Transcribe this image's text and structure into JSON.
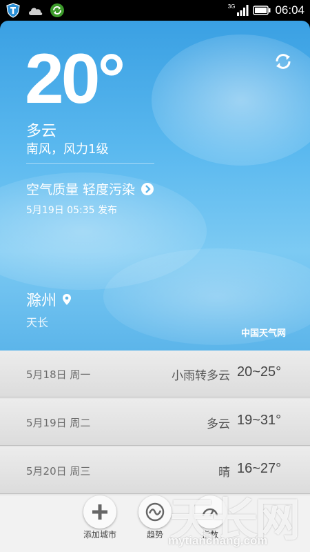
{
  "status_bar": {
    "time": "06:04",
    "network": "3G",
    "icons": [
      "shield-app-icon",
      "cloud-icon",
      "sync-app-icon",
      "signal-icon",
      "battery-icon"
    ]
  },
  "current": {
    "temperature": "20°",
    "condition": "多云",
    "wind": "南风，风力1级",
    "air_quality": "空气质量 轻度污染",
    "published": "5月19日 05:35 发布",
    "city": "滁州",
    "district": "天长",
    "source": "中国天气网"
  },
  "forecast": [
    {
      "date": "5月18日 周一",
      "weather": "小雨转多云",
      "range": "20~25°"
    },
    {
      "date": "5月19日 周二",
      "weather": "多云",
      "range": "19~31°"
    },
    {
      "date": "5月20日 周三",
      "weather": "晴",
      "range": "16~27°"
    }
  ],
  "tabs": [
    {
      "label": "添加城市",
      "icon": "plus-icon"
    },
    {
      "label": "趋势",
      "icon": "trend-icon"
    },
    {
      "label": "指数",
      "icon": "index-icon"
    }
  ],
  "watermark": {
    "text": "天长网",
    "url": "mytianchang.com"
  },
  "colors": {
    "sky_top": "#3aa0e3",
    "sky_bottom": "#5cb5ea",
    "forecast_bg": "#e6e6e6"
  }
}
